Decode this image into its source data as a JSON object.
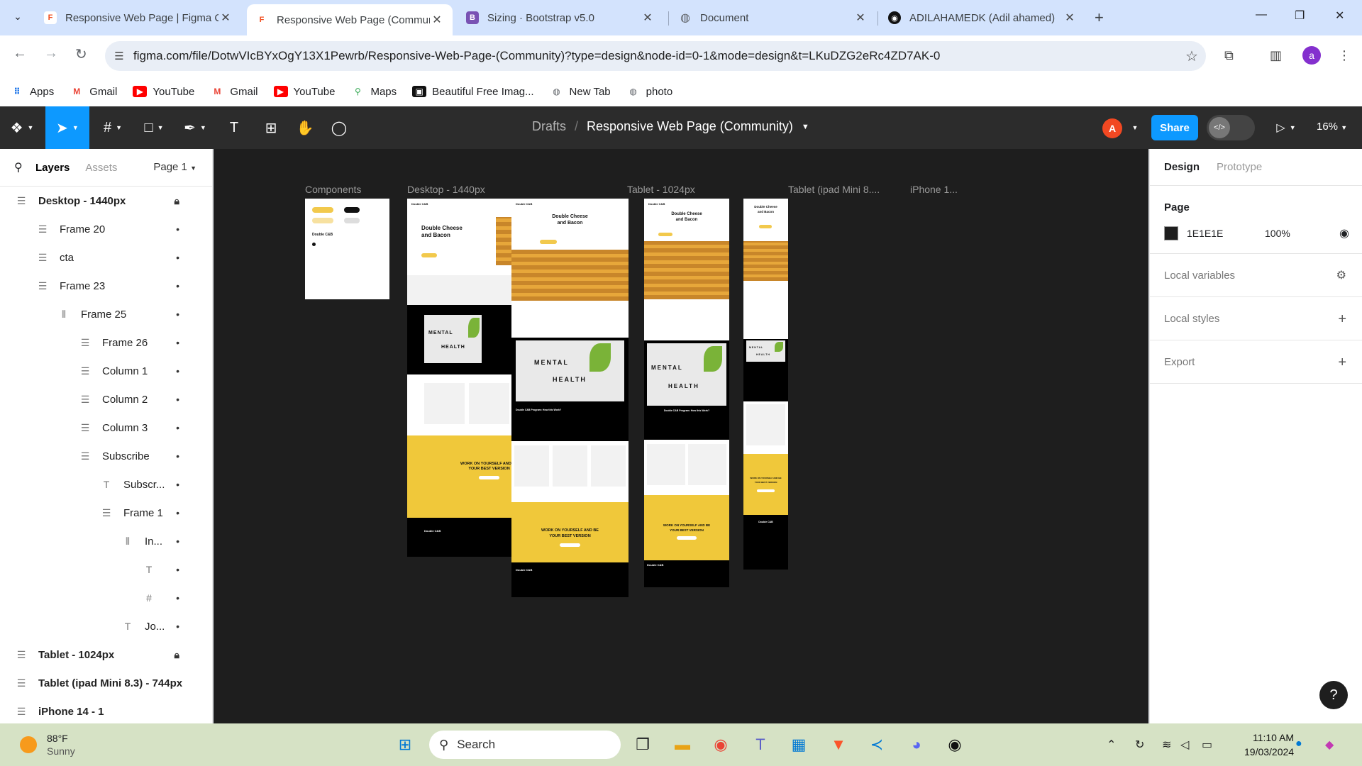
{
  "browser": {
    "tabs": [
      {
        "title": "Responsive Web Page | Figma C",
        "active": false
      },
      {
        "title": "Responsive Web Page (Commun",
        "active": true
      },
      {
        "title": "Sizing · Bootstrap v5.0",
        "active": false
      },
      {
        "title": "Document",
        "active": false
      },
      {
        "title": "ADILAHAMEDK (Adil ahamed)",
        "active": false
      }
    ],
    "url": "figma.com/file/DotwVIcBYxOgY13X1Pewrb/Responsive-Web-Page-(Community)?type=design&node-id=0-1&mode=design&t=LKuDZG2eRc4ZD7AK-0",
    "profile_initial": "a",
    "bookmarks": [
      "Apps",
      "Gmail",
      "YouTube",
      "Gmail",
      "YouTube",
      "Maps",
      "Beautiful Free Imag...",
      "New Tab",
      "photo"
    ]
  },
  "figma": {
    "breadcrumb_root": "Drafts",
    "breadcrumb_sep": "/",
    "file_title": "Responsive Web Page (Community)",
    "avatar_initial": "A",
    "share_label": "Share",
    "zoom": "16%",
    "left_tabs": {
      "layers": "Layers",
      "assets": "Assets",
      "page": "Page 1"
    },
    "layers": [
      {
        "name": "Desktop - 1440px",
        "indent": 0,
        "top": true,
        "icon": "frame",
        "tail": "lock"
      },
      {
        "name": "Frame 20",
        "indent": 1,
        "icon": "frame",
        "tail": "dot"
      },
      {
        "name": "cta",
        "indent": 1,
        "icon": "frame",
        "tail": "dot"
      },
      {
        "name": "Frame 23",
        "indent": 1,
        "icon": "frame",
        "tail": "dot"
      },
      {
        "name": "Frame 25",
        "indent": 2,
        "icon": "autolayout",
        "tail": "dot"
      },
      {
        "name": "Frame 26",
        "indent": 3,
        "icon": "frame",
        "tail": "dot"
      },
      {
        "name": "Column 1",
        "indent": 3,
        "icon": "frame",
        "tail": "dot"
      },
      {
        "name": "Column 2",
        "indent": 3,
        "icon": "frame",
        "tail": "dot"
      },
      {
        "name": "Column 3",
        "indent": 3,
        "icon": "frame",
        "tail": "dot"
      },
      {
        "name": "Subscribe",
        "indent": 3,
        "icon": "frame",
        "tail": "dot"
      },
      {
        "name": "Subscr...",
        "indent": 4,
        "icon": "text",
        "tail": "dot"
      },
      {
        "name": "Frame 1",
        "indent": 4,
        "icon": "frame",
        "tail": "dot"
      },
      {
        "name": "In...",
        "indent": 5,
        "icon": "autolayout",
        "tail": "dot"
      },
      {
        "name": "",
        "indent": 6,
        "icon": "text",
        "tail": "dot"
      },
      {
        "name": "",
        "indent": 6,
        "icon": "hash",
        "tail": "dot"
      },
      {
        "name": "Jo...",
        "indent": 5,
        "icon": "text",
        "tail": "dot"
      },
      {
        "name": "Tablet - 1024px",
        "indent": 0,
        "top": true,
        "icon": "frame",
        "tail": "lock"
      },
      {
        "name": "Tablet (ipad Mini 8.3) - 744px",
        "indent": 0,
        "top": true,
        "icon": "frame",
        "tail": ""
      },
      {
        "name": "iPhone 14 - 1",
        "indent": 0,
        "top": true,
        "icon": "frame",
        "tail": ""
      }
    ],
    "canvas_labels": {
      "components": "Components",
      "desktop": "Desktop - 1440px",
      "tablet": "Tablet - 1024px",
      "ipad": "Tablet (ipad Mini 8....",
      "iphone": "iPhone 1..."
    },
    "frame_text": {
      "brand": "Double C&B",
      "hero_title_1": "Double Cheese",
      "hero_title_2": "and Bacon",
      "tile_word_1": "MENTAL",
      "tile_word_2": "HEALTH",
      "how_title": "Double C&B Program: How this Work?",
      "cta_title_1": "WORK ON YOURSELF AND BE",
      "cta_title_2": "YOUR BEST VERSION"
    },
    "right_panel": {
      "tab_design": "Design",
      "tab_prototype": "Prototype",
      "page_heading": "Page",
      "page_color": "1E1E1E",
      "page_opacity": "100%",
      "local_variables": "Local variables",
      "local_styles": "Local styles",
      "export": "Export"
    },
    "help_label": "?"
  },
  "taskbar": {
    "temperature": "88°F",
    "condition": "Sunny",
    "search_label": "Search",
    "time": "11:10 AM",
    "date": "19/03/2024"
  },
  "colors": {
    "figma_accent": "#0d99ff",
    "canvas_bg": "#1e1e1e",
    "brand_yellow": "#f2c94c"
  }
}
